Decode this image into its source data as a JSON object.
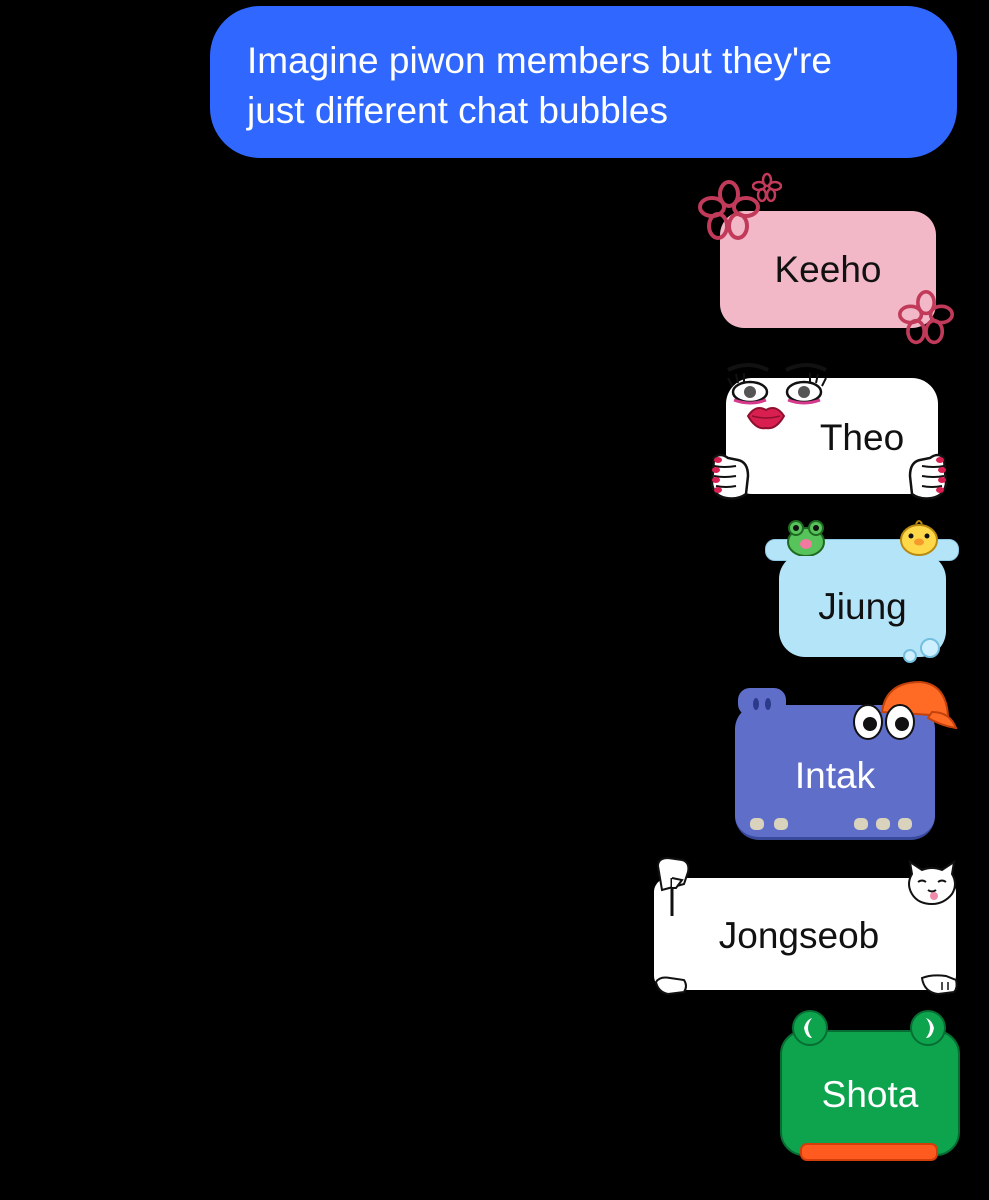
{
  "prompt": {
    "text": "Imagine piwon members but they're\njust different chat bubbles"
  },
  "bubbles": [
    {
      "label": "Keeho",
      "color": "#f2b8c8"
    },
    {
      "label": "Theo",
      "color": "#ffffff"
    },
    {
      "label": "Jiung",
      "color": "#b4e4f8"
    },
    {
      "label": "Intak",
      "color": "#5f6fc9"
    },
    {
      "label": "Jongseob",
      "color": "#ffffff"
    },
    {
      "label": "Shota",
      "color": "#0ea44e"
    }
  ],
  "colors": {
    "background": "#000000",
    "prompt_bubble": "#3068ff"
  }
}
